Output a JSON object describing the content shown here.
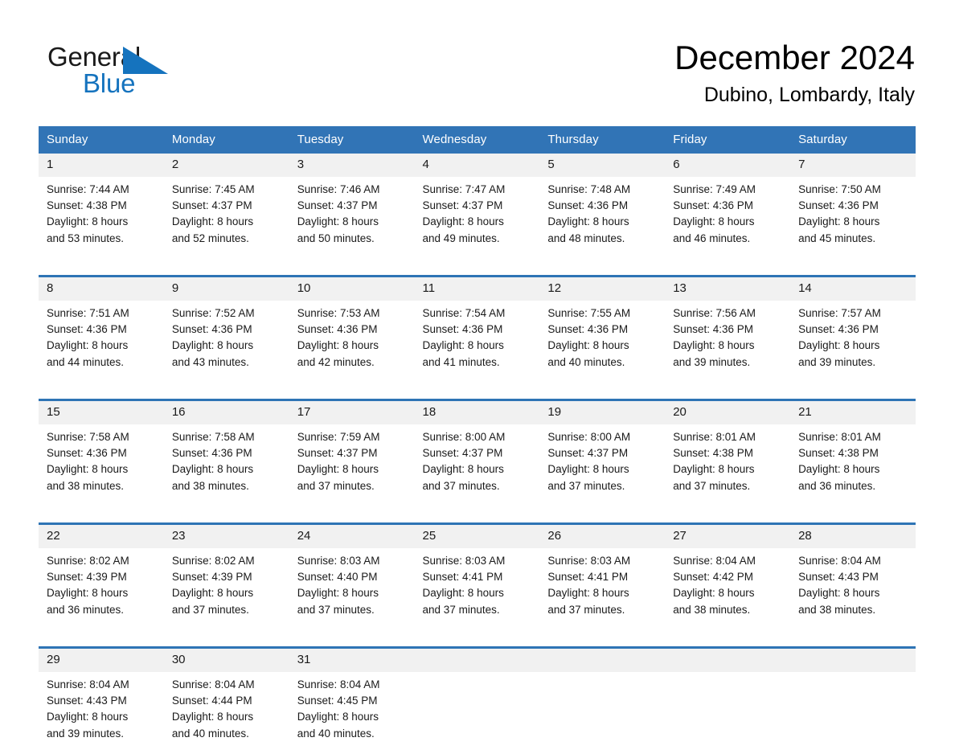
{
  "brand": {
    "name_part1": "General",
    "name_part2": "Blue",
    "logo_icon": "triangle-flag-icon",
    "accent_color": "#1573be"
  },
  "header": {
    "title": "December 2024",
    "subtitle": "Dubino, Lombardy, Italy"
  },
  "colors": {
    "header_blue": "#3174B6",
    "divider_blue": "#2E74B5",
    "daynum_band": "#f1f1f1",
    "text": "#1a1a1a"
  },
  "calendar": {
    "weekday_headers": [
      "Sunday",
      "Monday",
      "Tuesday",
      "Wednesday",
      "Thursday",
      "Friday",
      "Saturday"
    ],
    "weeks": [
      [
        {
          "day": "1",
          "sunrise": "Sunrise: 7:44 AM",
          "sunset": "Sunset: 4:38 PM",
          "daylight_line1": "Daylight: 8 hours",
          "daylight_line2": "and 53 minutes."
        },
        {
          "day": "2",
          "sunrise": "Sunrise: 7:45 AM",
          "sunset": "Sunset: 4:37 PM",
          "daylight_line1": "Daylight: 8 hours",
          "daylight_line2": "and 52 minutes."
        },
        {
          "day": "3",
          "sunrise": "Sunrise: 7:46 AM",
          "sunset": "Sunset: 4:37 PM",
          "daylight_line1": "Daylight: 8 hours",
          "daylight_line2": "and 50 minutes."
        },
        {
          "day": "4",
          "sunrise": "Sunrise: 7:47 AM",
          "sunset": "Sunset: 4:37 PM",
          "daylight_line1": "Daylight: 8 hours",
          "daylight_line2": "and 49 minutes."
        },
        {
          "day": "5",
          "sunrise": "Sunrise: 7:48 AM",
          "sunset": "Sunset: 4:36 PM",
          "daylight_line1": "Daylight: 8 hours",
          "daylight_line2": "and 48 minutes."
        },
        {
          "day": "6",
          "sunrise": "Sunrise: 7:49 AM",
          "sunset": "Sunset: 4:36 PM",
          "daylight_line1": "Daylight: 8 hours",
          "daylight_line2": "and 46 minutes."
        },
        {
          "day": "7",
          "sunrise": "Sunrise: 7:50 AM",
          "sunset": "Sunset: 4:36 PM",
          "daylight_line1": "Daylight: 8 hours",
          "daylight_line2": "and 45 minutes."
        }
      ],
      [
        {
          "day": "8",
          "sunrise": "Sunrise: 7:51 AM",
          "sunset": "Sunset: 4:36 PM",
          "daylight_line1": "Daylight: 8 hours",
          "daylight_line2": "and 44 minutes."
        },
        {
          "day": "9",
          "sunrise": "Sunrise: 7:52 AM",
          "sunset": "Sunset: 4:36 PM",
          "daylight_line1": "Daylight: 8 hours",
          "daylight_line2": "and 43 minutes."
        },
        {
          "day": "10",
          "sunrise": "Sunrise: 7:53 AM",
          "sunset": "Sunset: 4:36 PM",
          "daylight_line1": "Daylight: 8 hours",
          "daylight_line2": "and 42 minutes."
        },
        {
          "day": "11",
          "sunrise": "Sunrise: 7:54 AM",
          "sunset": "Sunset: 4:36 PM",
          "daylight_line1": "Daylight: 8 hours",
          "daylight_line2": "and 41 minutes."
        },
        {
          "day": "12",
          "sunrise": "Sunrise: 7:55 AM",
          "sunset": "Sunset: 4:36 PM",
          "daylight_line1": "Daylight: 8 hours",
          "daylight_line2": "and 40 minutes."
        },
        {
          "day": "13",
          "sunrise": "Sunrise: 7:56 AM",
          "sunset": "Sunset: 4:36 PM",
          "daylight_line1": "Daylight: 8 hours",
          "daylight_line2": "and 39 minutes."
        },
        {
          "day": "14",
          "sunrise": "Sunrise: 7:57 AM",
          "sunset": "Sunset: 4:36 PM",
          "daylight_line1": "Daylight: 8 hours",
          "daylight_line2": "and 39 minutes."
        }
      ],
      [
        {
          "day": "15",
          "sunrise": "Sunrise: 7:58 AM",
          "sunset": "Sunset: 4:36 PM",
          "daylight_line1": "Daylight: 8 hours",
          "daylight_line2": "and 38 minutes."
        },
        {
          "day": "16",
          "sunrise": "Sunrise: 7:58 AM",
          "sunset": "Sunset: 4:36 PM",
          "daylight_line1": "Daylight: 8 hours",
          "daylight_line2": "and 38 minutes."
        },
        {
          "day": "17",
          "sunrise": "Sunrise: 7:59 AM",
          "sunset": "Sunset: 4:37 PM",
          "daylight_line1": "Daylight: 8 hours",
          "daylight_line2": "and 37 minutes."
        },
        {
          "day": "18",
          "sunrise": "Sunrise: 8:00 AM",
          "sunset": "Sunset: 4:37 PM",
          "daylight_line1": "Daylight: 8 hours",
          "daylight_line2": "and 37 minutes."
        },
        {
          "day": "19",
          "sunrise": "Sunrise: 8:00 AM",
          "sunset": "Sunset: 4:37 PM",
          "daylight_line1": "Daylight: 8 hours",
          "daylight_line2": "and 37 minutes."
        },
        {
          "day": "20",
          "sunrise": "Sunrise: 8:01 AM",
          "sunset": "Sunset: 4:38 PM",
          "daylight_line1": "Daylight: 8 hours",
          "daylight_line2": "and 37 minutes."
        },
        {
          "day": "21",
          "sunrise": "Sunrise: 8:01 AM",
          "sunset": "Sunset: 4:38 PM",
          "daylight_line1": "Daylight: 8 hours",
          "daylight_line2": "and 36 minutes."
        }
      ],
      [
        {
          "day": "22",
          "sunrise": "Sunrise: 8:02 AM",
          "sunset": "Sunset: 4:39 PM",
          "daylight_line1": "Daylight: 8 hours",
          "daylight_line2": "and 36 minutes."
        },
        {
          "day": "23",
          "sunrise": "Sunrise: 8:02 AM",
          "sunset": "Sunset: 4:39 PM",
          "daylight_line1": "Daylight: 8 hours",
          "daylight_line2": "and 37 minutes."
        },
        {
          "day": "24",
          "sunrise": "Sunrise: 8:03 AM",
          "sunset": "Sunset: 4:40 PM",
          "daylight_line1": "Daylight: 8 hours",
          "daylight_line2": "and 37 minutes."
        },
        {
          "day": "25",
          "sunrise": "Sunrise: 8:03 AM",
          "sunset": "Sunset: 4:41 PM",
          "daylight_line1": "Daylight: 8 hours",
          "daylight_line2": "and 37 minutes."
        },
        {
          "day": "26",
          "sunrise": "Sunrise: 8:03 AM",
          "sunset": "Sunset: 4:41 PM",
          "daylight_line1": "Daylight: 8 hours",
          "daylight_line2": "and 37 minutes."
        },
        {
          "day": "27",
          "sunrise": "Sunrise: 8:04 AM",
          "sunset": "Sunset: 4:42 PM",
          "daylight_line1": "Daylight: 8 hours",
          "daylight_line2": "and 38 minutes."
        },
        {
          "day": "28",
          "sunrise": "Sunrise: 8:04 AM",
          "sunset": "Sunset: 4:43 PM",
          "daylight_line1": "Daylight: 8 hours",
          "daylight_line2": "and 38 minutes."
        }
      ],
      [
        {
          "day": "29",
          "sunrise": "Sunrise: 8:04 AM",
          "sunset": "Sunset: 4:43 PM",
          "daylight_line1": "Daylight: 8 hours",
          "daylight_line2": "and 39 minutes."
        },
        {
          "day": "30",
          "sunrise": "Sunrise: 8:04 AM",
          "sunset": "Sunset: 4:44 PM",
          "daylight_line1": "Daylight: 8 hours",
          "daylight_line2": "and 40 minutes."
        },
        {
          "day": "31",
          "sunrise": "Sunrise: 8:04 AM",
          "sunset": "Sunset: 4:45 PM",
          "daylight_line1": "Daylight: 8 hours",
          "daylight_line2": "and 40 minutes."
        },
        {
          "day": "",
          "sunrise": "",
          "sunset": "",
          "daylight_line1": "",
          "daylight_line2": ""
        },
        {
          "day": "",
          "sunrise": "",
          "sunset": "",
          "daylight_line1": "",
          "daylight_line2": ""
        },
        {
          "day": "",
          "sunrise": "",
          "sunset": "",
          "daylight_line1": "",
          "daylight_line2": ""
        },
        {
          "day": "",
          "sunrise": "",
          "sunset": "",
          "daylight_line1": "",
          "daylight_line2": ""
        }
      ]
    ]
  }
}
